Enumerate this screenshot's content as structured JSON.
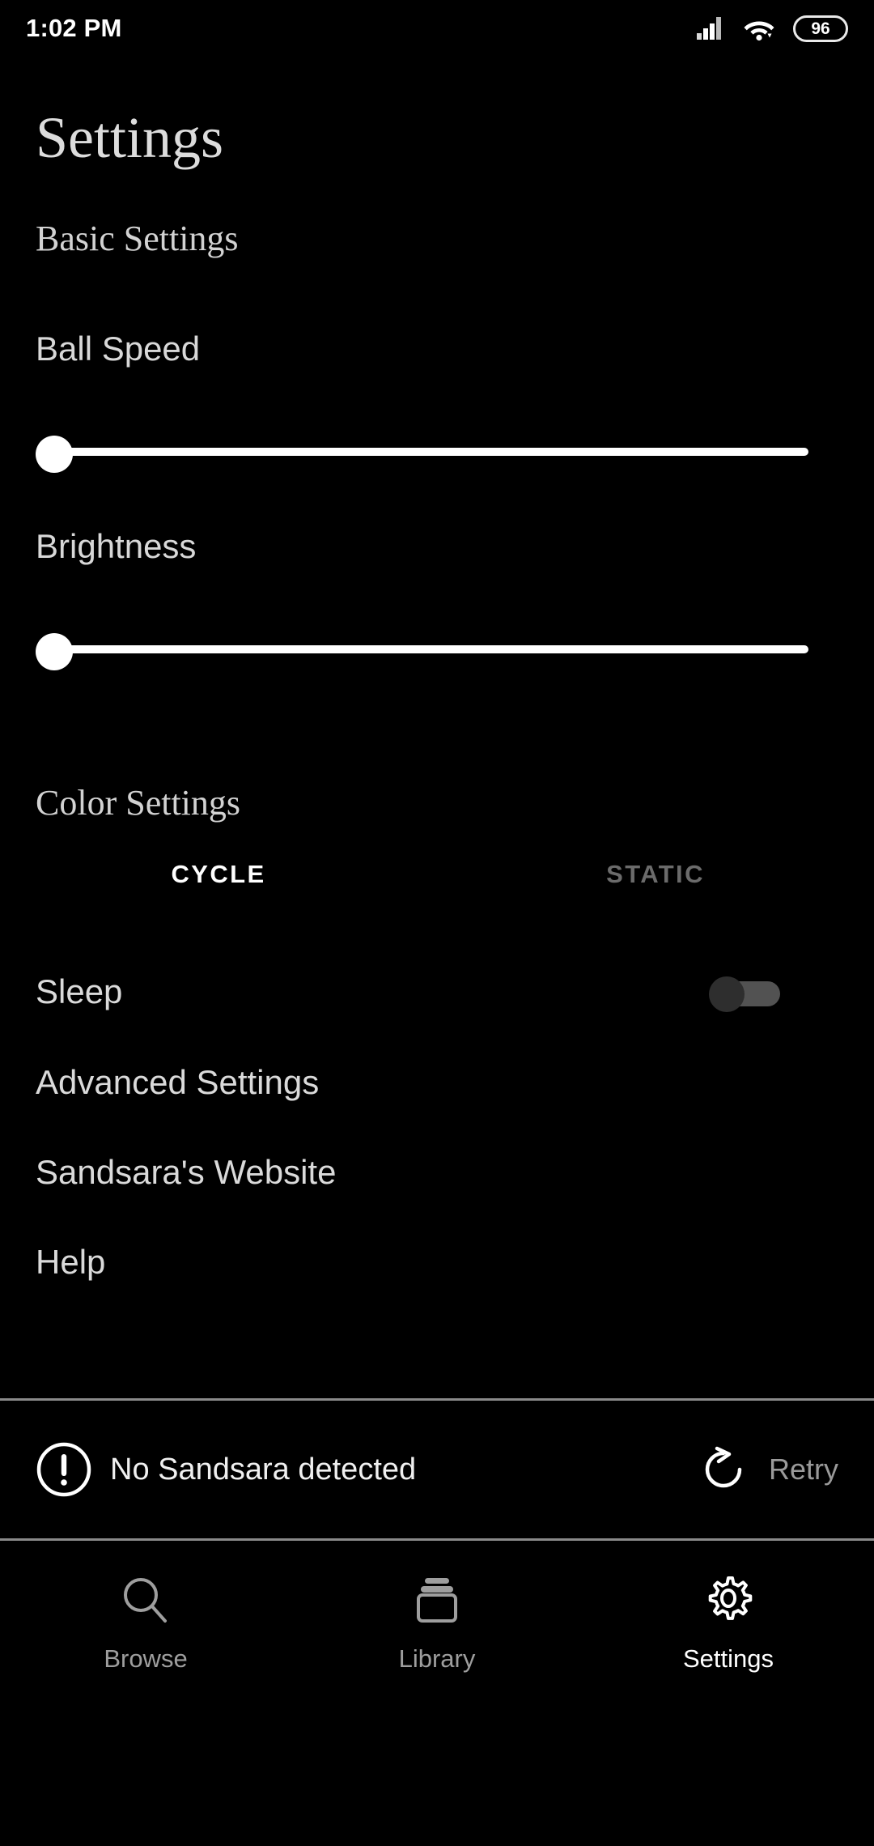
{
  "statusbar": {
    "time": "1:02 PM",
    "battery_level": "96",
    "signal_icon": "signal-bars-icon",
    "wifi_icon": "wifi-icon",
    "battery_icon": "battery-icon"
  },
  "header": {
    "title": "Settings"
  },
  "sections": {
    "basic": "Basic Settings",
    "color": "Color Settings"
  },
  "sliders": [
    {
      "label": "Ball Speed",
      "value": 0,
      "min": 0,
      "max": 100
    },
    {
      "label": "Brightness",
      "value": 0,
      "min": 0,
      "max": 100
    }
  ],
  "color_tabs": [
    {
      "label": "CYCLE",
      "active": true
    },
    {
      "label": "STATIC",
      "active": false
    }
  ],
  "rows": {
    "sleep": {
      "label": "Sleep",
      "toggle_on": false
    },
    "advanced": {
      "label": "Advanced Settings"
    },
    "website": {
      "label": "Sandsara's Website"
    },
    "help": {
      "label": "Help"
    }
  },
  "connection": {
    "icon": "alert-circle-icon",
    "message": "No Sandsara detected",
    "retry_icon": "refresh-icon",
    "retry_label": "Retry"
  },
  "bottom_nav": [
    {
      "label": "Browse",
      "icon": "search-icon",
      "active": false
    },
    {
      "label": "Library",
      "icon": "library-icon",
      "active": false
    },
    {
      "label": "Settings",
      "icon": "gear-icon",
      "active": true
    }
  ],
  "colors": {
    "background": "#000000",
    "primary_text": "#ffffff",
    "muted_text": "#9a9a9a",
    "divider": "#8a8a8a",
    "slider_track": "#ffffff",
    "toggle_track_off": "#525252",
    "toggle_thumb_off": "#2e2e2e"
  }
}
